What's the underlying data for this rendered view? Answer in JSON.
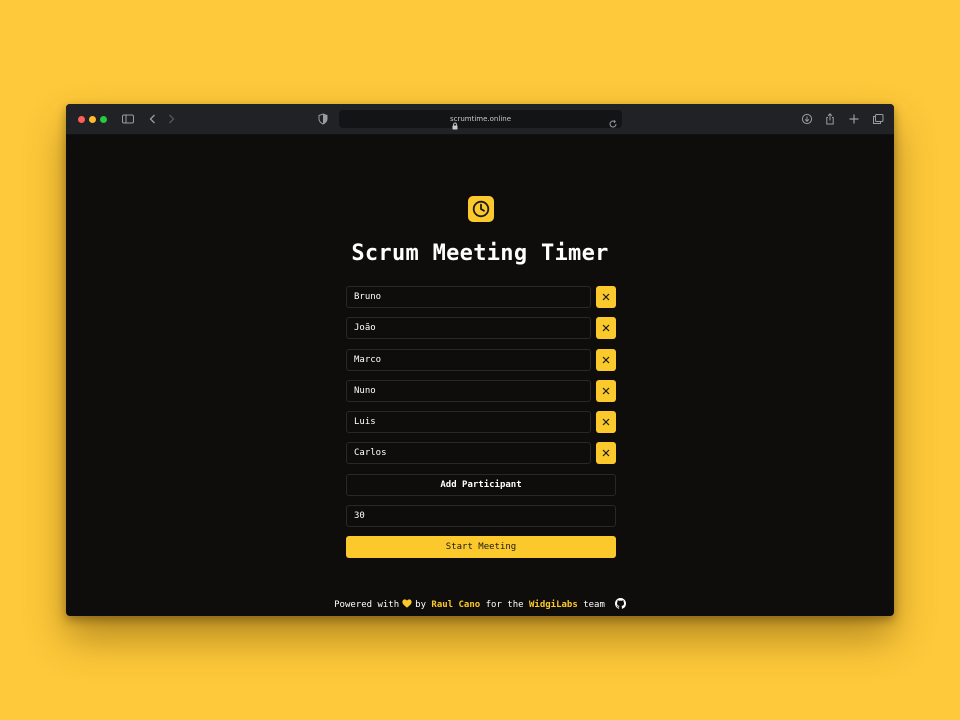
{
  "browser": {
    "url": "scrumtime.online",
    "traffic_lights": [
      "#ff5f57",
      "#febc2e",
      "#28c840"
    ],
    "icons": [
      "sidebar-icon",
      "back-icon",
      "forward-icon",
      "shield-icon",
      "lock-icon",
      "reload-icon",
      "download-icon",
      "share-icon",
      "new-tab-icon",
      "tabs-overview-icon"
    ]
  },
  "app": {
    "logo_icon": "clock-icon",
    "title": "Scrum Meeting Timer",
    "participants": [
      {
        "name": "Bruno"
      },
      {
        "name": "João"
      },
      {
        "name": "Marco"
      },
      {
        "name": "Nuno"
      },
      {
        "name": "Luis"
      },
      {
        "name": "Carlos"
      }
    ],
    "remove_icon": "close-icon",
    "add_participant_label": "Add Participant",
    "duration_value": "30",
    "start_label": "Start Meeting",
    "accent_color": "#fcc92c",
    "background_color": "#fec93a"
  },
  "footer": {
    "powered_with": "Powered with",
    "by": "by",
    "author": "Raul Cano",
    "for_the": "for the",
    "team_name": "WidgiLabs",
    "team": "team",
    "icons": [
      "heart-icon",
      "github-icon"
    ]
  }
}
